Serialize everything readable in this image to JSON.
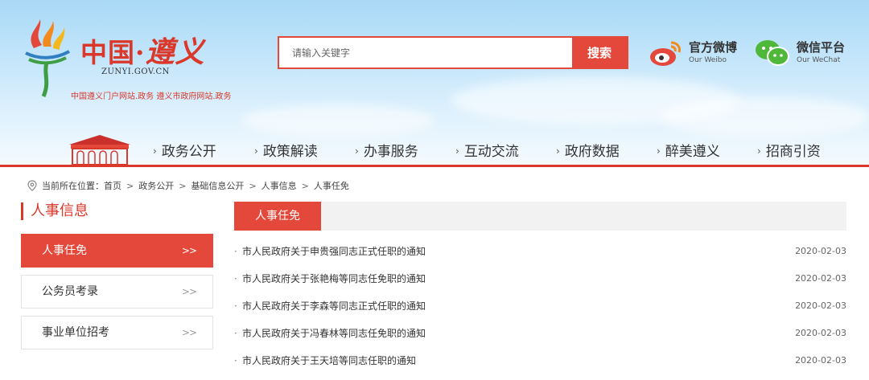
{
  "header": {
    "logo": {
      "title_cn": "中国·",
      "title_script": "遵义",
      "domain": "ZUNYI.GOV.CN",
      "subtitle": "中国遵义门户网站.政务  遵义市政府网站.政务"
    },
    "search": {
      "placeholder": "请输入关键字",
      "button_label": "搜索"
    },
    "social": [
      {
        "title": "官方微博",
        "subtitle": "Our Weibo",
        "icon": "weibo-icon"
      },
      {
        "title": "微信平台",
        "subtitle": "Our WeChat",
        "icon": "wechat-icon"
      }
    ],
    "nav": [
      "政务公开",
      "政策解读",
      "办事服务",
      "互动交流",
      "政府数据",
      "醉美遵义",
      "招商引资"
    ],
    "colors": {
      "accent": "#e4483b",
      "sky": "#a9d9f6"
    }
  },
  "breadcrumb": {
    "label": "当前所在位置：",
    "items": [
      "首页",
      "政务公开",
      "基础信息公开",
      "人事信息",
      "人事任免"
    ]
  },
  "sidebar": {
    "title": "人事信息",
    "items": [
      {
        "label": "人事任免",
        "active": true
      },
      {
        "label": "公务员考录",
        "active": false
      },
      {
        "label": "事业单位招考",
        "active": false
      }
    ],
    "chevron": ">>"
  },
  "content": {
    "active_tab": "人事任免",
    "bullet": "·",
    "articles": [
      {
        "title": "市人民政府关于申贵强同志正式任职的通知",
        "date": "2020-02-03"
      },
      {
        "title": "市人民政府关于张艳梅等同志任免职的通知",
        "date": "2020-02-03"
      },
      {
        "title": "市人民政府关于李森等同志正式任职的通知",
        "date": "2020-02-03"
      },
      {
        "title": "市人民政府关于冯春林等同志任免职的通知",
        "date": "2020-02-03"
      },
      {
        "title": "市人民政府关于王天培等同志任职的通知",
        "date": "2020-02-03"
      }
    ]
  }
}
